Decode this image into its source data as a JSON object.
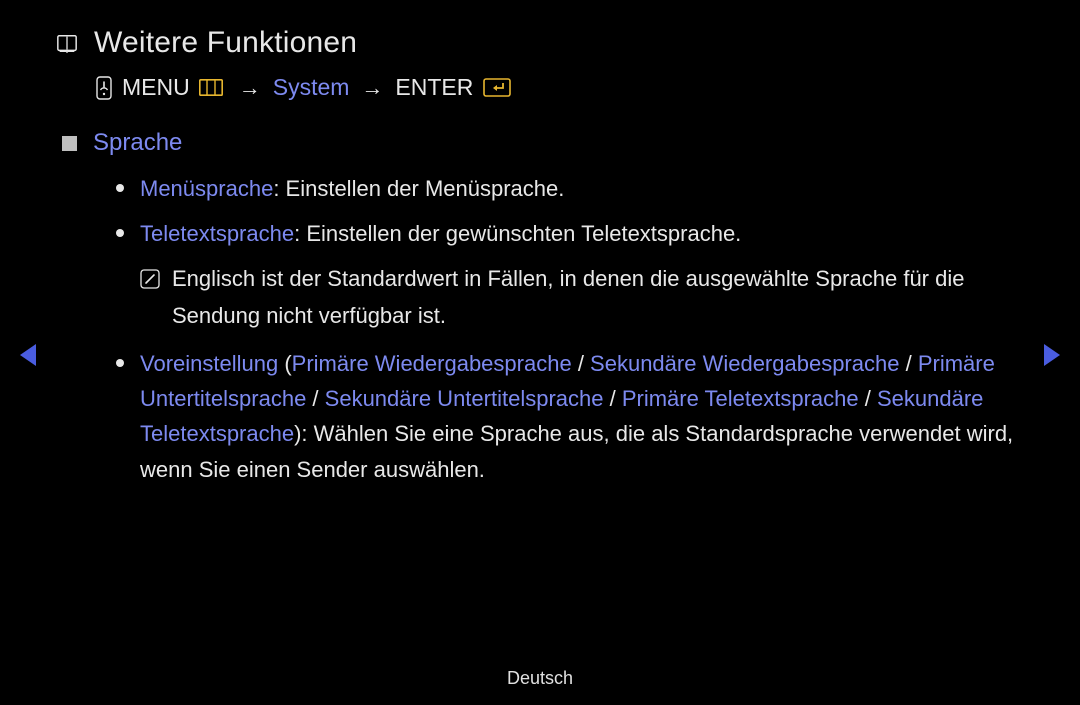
{
  "title": "Weitere Funktionen",
  "breadcrumb": {
    "menu": "MENU",
    "arrow": "→",
    "system": "System",
    "enter": "ENTER"
  },
  "section": {
    "title": "Sprache",
    "items": [
      {
        "term": "Menüsprache",
        "desc": ": Einstellen der Menüsprache."
      },
      {
        "term": "Teletextsprache",
        "desc": ": Einstellen der gewünschten Teletextsprache.",
        "note": "Englisch ist der Standardwert in Fällen, in denen die ausgewählte Sprache für die Sendung nicht verfügbar ist."
      }
    ],
    "preset": {
      "term": "Voreinstellung",
      "open": " (",
      "sep": " / ",
      "options": [
        "Primäre Wiedergabesprache",
        "Sekundäre Wiedergabesprache",
        "Primäre Untertitelsprache",
        "Sekundäre Untertitelsprache",
        "Primäre Teletextsprache",
        "Sekundäre Teletextsprache"
      ],
      "close": "): ",
      "desc": "Wählen Sie eine Sprache aus, die als Standardsprache verwendet wird, wenn Sie einen Sender auswählen."
    }
  },
  "footer": "Deutsch"
}
